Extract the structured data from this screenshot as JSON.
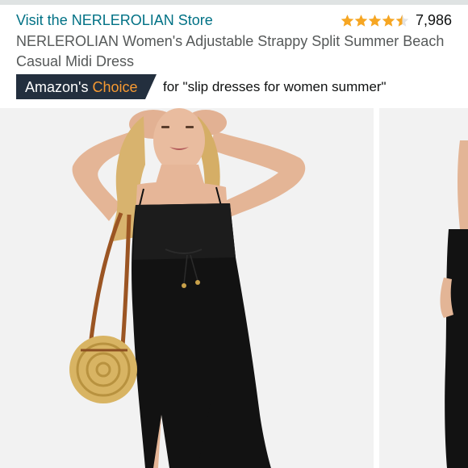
{
  "store": {
    "link_text": "Visit the NERLEROLIAN Store"
  },
  "rating": {
    "stars": 4.5,
    "star_color": "#F6A623",
    "count": "7,986"
  },
  "product": {
    "title": "NERLEROLIAN Women's Adjustable Strappy Split Summer Beach Casual Midi Dress"
  },
  "badge": {
    "prefix": "Amazon's",
    "highlight": "Choice",
    "query": "for \"slip dresses for women summer\"",
    "background_color": "#232F3E",
    "highlight_color": "#F69931"
  },
  "gallery": {
    "main_image_alt": "woman wearing black strappy midi dress with round rattan bag",
    "next_image_alt": "black dress side view"
  }
}
